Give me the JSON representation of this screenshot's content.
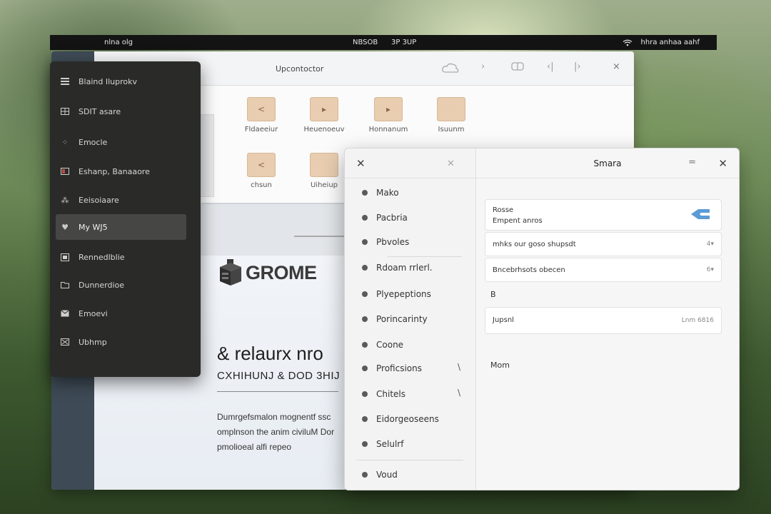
{
  "topbar": {
    "left": "nlna olg",
    "clock": "NBSOB",
    "extra": "3P 3UP",
    "right": "hhra anhaa aahf",
    "icons": [
      "wifi-icon"
    ]
  },
  "files": {
    "path": "Upcontoctor",
    "toolbar_icons": [
      "cloud-icon",
      "chevron-right-icon",
      "view-icon",
      "back-icon",
      "forward-icon",
      "close-icon"
    ],
    "items": [
      {
        "label": "Fldaeeiur",
        "glyph": "<"
      },
      {
        "label": "Heuenoeuv",
        "glyph": "▸"
      },
      {
        "label": "Honnanum",
        "glyph": "▸"
      },
      {
        "label": "Isuunm",
        "glyph": ""
      },
      {
        "label": "chsun",
        "glyph": "<"
      },
      {
        "label": "Uiheiup",
        "glyph": ""
      }
    ],
    "doc": {
      "logo_text": "GROME",
      "headline": "& relaurx nro",
      "subhead": "CXHIHUNJ & DOD 3HIJ",
      "paragraph": [
        "Dumrgefsmalon mognentf ssc",
        "omplnson the anim civiluM Dor",
        "pmolioeal alfi repeo"
      ]
    }
  },
  "menu": {
    "items": [
      {
        "label": "Blaind Iluprokv",
        "icon": "list-icon",
        "active": false
      },
      {
        "label": "SDIT asare",
        "icon": "grid-icon",
        "active": false
      },
      {
        "label": "Emocle",
        "icon": "dots-icon",
        "active": false
      },
      {
        "label": "Eshanp,  Banaaore",
        "icon": "image-icon",
        "active": false
      },
      {
        "label": "Eeisoiaare",
        "icon": "people-icon",
        "active": false
      },
      {
        "label": "My WJ5",
        "icon": "heart-icon",
        "active": true
      },
      {
        "label": "Rennedlblie",
        "icon": "box-icon",
        "active": false
      },
      {
        "label": "Dunnerdioe",
        "icon": "folder-icon",
        "active": false
      },
      {
        "label": "Emoevi",
        "icon": "mail-icon",
        "active": false
      },
      {
        "label": "Ubhmp",
        "icon": "x-box-icon",
        "active": false
      }
    ]
  },
  "settings": {
    "title": "Smara",
    "categories": [
      {
        "label": "Mako"
      },
      {
        "label": "Pacbria"
      },
      {
        "label": "Pbvoles"
      },
      {
        "label": "Rdoam rrlerl."
      },
      {
        "label": "Plyepeptions"
      },
      {
        "label": "Porincarinty"
      },
      {
        "label": "Coone"
      },
      {
        "label": "Proficsions",
        "mark": "\\"
      },
      {
        "label": "Chitels",
        "mark": "\\"
      },
      {
        "label": "Eidorgeoseens"
      },
      {
        "label": "Selulrf"
      },
      {
        "label": "Voud"
      }
    ],
    "cards": [
      {
        "line1": "Rosse",
        "line2": "Empent anros",
        "accent": "#5b9bd5"
      },
      {
        "text": "mhks our goso shupsdt",
        "value": "4▾"
      },
      {
        "text": "Bncebrhsots obecen",
        "value": "6▾"
      },
      {
        "text": "Jupsnl",
        "value": "Lnm 6816"
      }
    ],
    "section_b": "B",
    "section_mom": "Mom"
  }
}
